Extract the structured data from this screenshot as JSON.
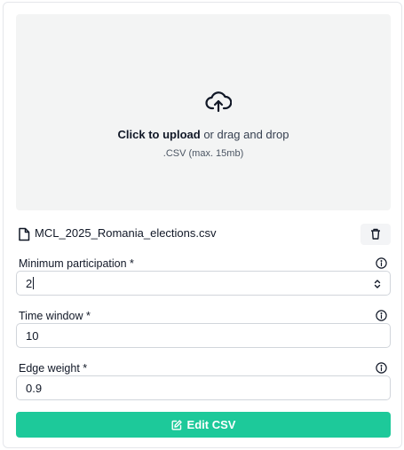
{
  "upload": {
    "icon": "cloud-upload-icon",
    "click_text": "Click to upload",
    "rest_text": " or drag and drop",
    "hint": ".CSV (max. 15mb)"
  },
  "file": {
    "icon": "file-icon",
    "name": "MCL_2025_Romania_elections.csv",
    "delete_icon": "trash-icon"
  },
  "fields": {
    "min_participation": {
      "label": "Minimum participation *",
      "value": "2",
      "info_icon": "info-icon"
    },
    "time_window": {
      "label": "Time window *",
      "value": "10",
      "info_icon": "info-icon"
    },
    "edge_weight": {
      "label": "Edge weight *",
      "value": "0.9",
      "info_icon": "info-icon"
    }
  },
  "submit": {
    "label": "Edit CSV",
    "icon": "edit-icon"
  },
  "colors": {
    "accent": "#1dc99a",
    "dropzone_bg": "#f3f4f4",
    "border": "#d1d5db"
  }
}
